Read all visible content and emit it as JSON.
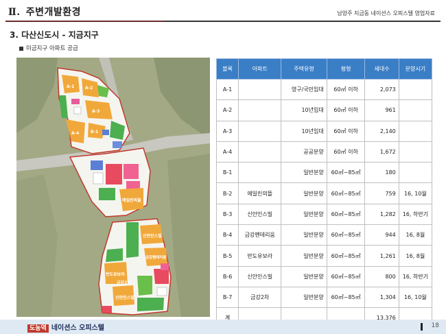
{
  "header": {
    "roman": "Ⅱ.",
    "title": "주변개발환경",
    "subtitle": "남양주 지금동 네이션스 오피스텔 영업자료"
  },
  "section": {
    "title": "3. 다산신도시 - 지금지구",
    "bullet": "미금지구 아파트 공급"
  },
  "map": {
    "labels": {
      "a1": "A-1",
      "a2": "A-2",
      "a3": "A-3",
      "a4": "A-4",
      "b1": "B-1",
      "b2": "에일린의뜰",
      "b3": "신안인스빌",
      "b4": "금강펜테리움",
      "b5": "반도유보라",
      "b6": "신안인스빌",
      "b7": "금강2차"
    }
  },
  "table": {
    "headers": [
      "블록",
      "아파트",
      "주택유형",
      "평형",
      "세대수",
      "분양시기"
    ],
    "rows": [
      [
        "A-1",
        "",
        "영구/국민임대",
        "60㎡ 이하",
        "2,073",
        ""
      ],
      [
        "A-2",
        "",
        "10년임대",
        "60㎡ 이하",
        "961",
        ""
      ],
      [
        "A-3",
        "",
        "10년임대",
        "60㎡ 이하",
        "2,140",
        ""
      ],
      [
        "A-4",
        "",
        "공공분양",
        "60㎡ 이하",
        "1,672",
        ""
      ],
      [
        "B-1",
        "",
        "일반분양",
        "60㎡~85㎡",
        "180",
        ""
      ],
      [
        "B-2",
        "에일린의뜰",
        "일반분양",
        "60㎡~85㎡",
        "759",
        "16, 10월"
      ],
      [
        "B-3",
        "신안인스빌",
        "일반분양",
        "60㎡~85㎡",
        "1,282",
        "16, 하반기"
      ],
      [
        "B-4",
        "금강펜테리움",
        "일반분양",
        "60㎡~85㎡",
        "944",
        "16, 8월"
      ],
      [
        "B-5",
        "반도유보라",
        "일반분양",
        "60㎡~85㎡",
        "1,261",
        "16, 8월"
      ],
      [
        "B-6",
        "신안인스빌",
        "일반분양",
        "60㎡~85㎡",
        "800",
        "16, 하반기"
      ],
      [
        "B-7",
        "금강2차",
        "일반분양",
        "60㎡~85㎡",
        "1,304",
        "16, 10월"
      ],
      [
        "계",
        "",
        "",
        "",
        "13,376",
        ""
      ]
    ]
  },
  "footer": {
    "tag": "도농역",
    "brand": "네이션스 오피스텔",
    "page": "18"
  }
}
